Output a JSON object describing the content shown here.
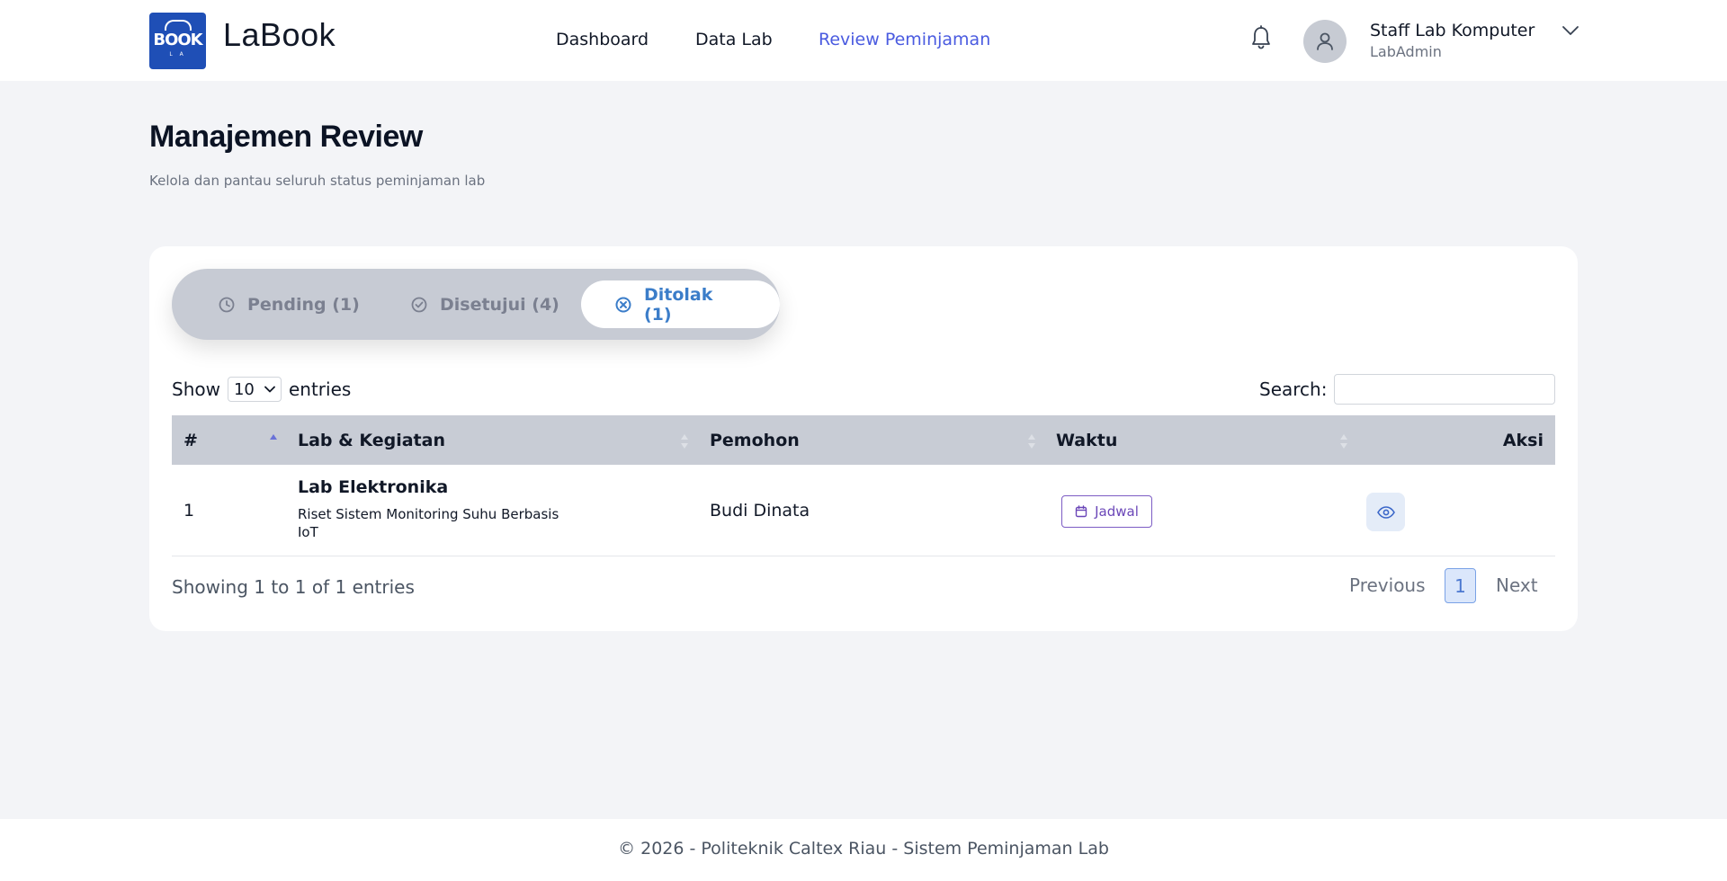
{
  "header": {
    "logo_text": "BOOK",
    "logo_subtext": "L A",
    "brand": "LaBook",
    "nav": [
      {
        "label": "Dashboard"
      },
      {
        "label": "Data Lab"
      },
      {
        "label": "Review Peminjaman",
        "active": true
      }
    ],
    "user": {
      "name": "Staff Lab Komputer",
      "role": "LabAdmin"
    }
  },
  "page": {
    "title": "Manajemen Review",
    "subtitle": "Kelola dan pantau seluruh status peminjaman lab"
  },
  "tabs": [
    {
      "label": "Pending (1)",
      "icon": "clock-icon"
    },
    {
      "label": "Disetujui (4)",
      "icon": "check-circle-icon"
    },
    {
      "label": "Ditolak (1)",
      "icon": "x-circle-icon",
      "active": true
    }
  ],
  "table_controls": {
    "show_label": "Show",
    "entries_value": "10",
    "entries_label": "entries",
    "search_label": "Search:",
    "search_value": ""
  },
  "table": {
    "columns": [
      "#",
      "Lab & Kegiatan",
      "Pemohon",
      "Waktu",
      "Aksi"
    ],
    "rows": [
      {
        "no": "1",
        "lab": "Lab Elektronika",
        "kegiatan_line1": "Riset Sistem Monitoring Suhu Berbasis",
        "kegiatan_line2": "IoT",
        "pemohon": "Budi Dinata",
        "waktu_button": "Jadwal"
      }
    ]
  },
  "pagination": {
    "info": "Showing 1 to 1 of 1 entries",
    "previous": "Previous",
    "current": "1",
    "next": "Next"
  },
  "footer": {
    "text": "© 2026 - Politeknik Caltex Riau - Sistem Peminjaman Lab"
  },
  "colors": {
    "accent": "#4a5be0",
    "tab_active": "#3b7dc9",
    "header_bg": "#c8ccd5",
    "jadwal": "#6b47b8",
    "logo_bg": "#1f4fb6"
  }
}
